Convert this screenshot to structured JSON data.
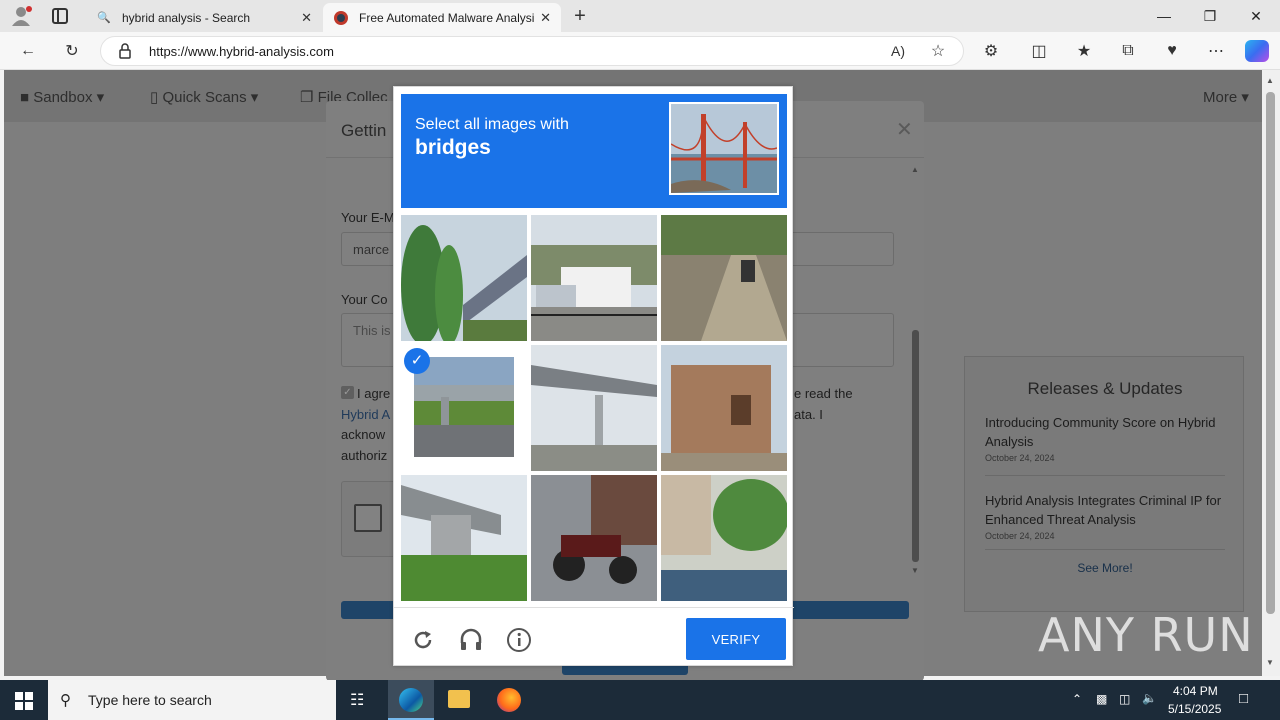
{
  "browser": {
    "tabs": [
      {
        "title": "hybrid analysis - Search",
        "active": false
      },
      {
        "title": "Free Automated Malware Analysis",
        "active": true
      }
    ],
    "url": "https://www.hybrid-analysis.com"
  },
  "nav": {
    "items": [
      "Sandbox",
      "Quick Scans",
      "File Collec"
    ],
    "more": "More"
  },
  "modal": {
    "title": "Gettin",
    "email_label": "Your E-M",
    "email_value": "marce",
    "comment_label": "Your Co",
    "comment_placeholder": "This is",
    "agree_line1": "I agre",
    "agree_line1_right": "e read the",
    "agree_link": "Hybrid A",
    "agree_line2_right": "ata. I",
    "agree_line3": "acknow",
    "agree_line4": "authoriz"
  },
  "releases": {
    "title": "Releases & Updates",
    "items": [
      {
        "title": "Introducing Community Score on Hybrid Analysis",
        "date": "October 24, 2024"
      },
      {
        "title": "Hybrid Analysis Integrates Criminal IP for Enhanced Threat Analysis",
        "date": "October 24, 2024"
      }
    ],
    "see_more": "See More!"
  },
  "captcha": {
    "instruction": "Select all images with",
    "target": "bridges",
    "verify_label": "VERIFY",
    "selected_tiles": [
      3
    ]
  },
  "taskbar": {
    "search_placeholder": "Type here to search",
    "time": "4:04 PM",
    "date": "5/15/2025"
  },
  "watermark": "ANY RUN",
  "colors": {
    "captcha_blue": "#1a73e8",
    "taskbar": "#1c2b39"
  }
}
